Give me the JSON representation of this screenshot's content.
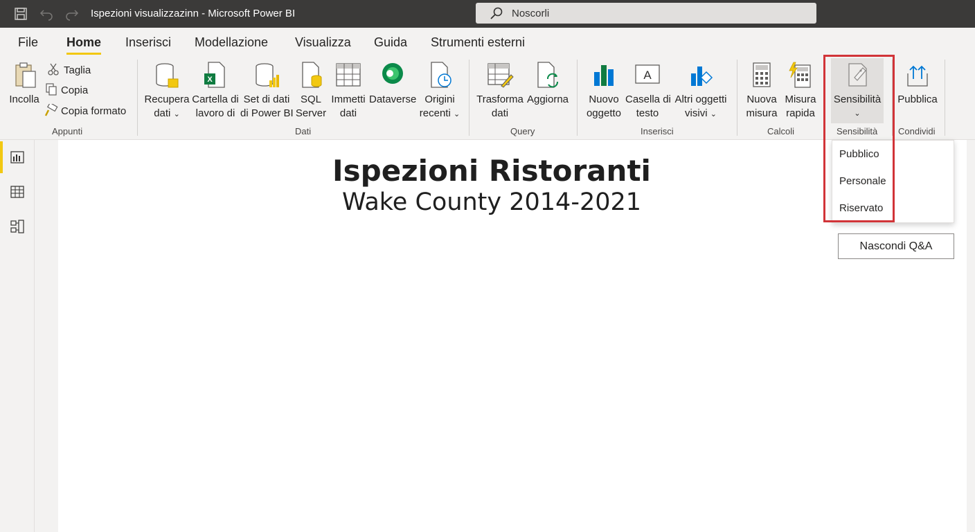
{
  "titlebar": {
    "title": "Ispezioni visualizzazinn  -  Microsoft Power BI",
    "save_icon": "save-icon",
    "undo_icon": "undo-icon",
    "redo_icon": "redo-icon"
  },
  "search": {
    "placeholder": "Noscorli"
  },
  "tabs": [
    {
      "label": "File"
    },
    {
      "label": "Home",
      "active": true
    },
    {
      "label": "Inserisci"
    },
    {
      "label": "Modellazione"
    },
    {
      "label": "Visualizza"
    },
    {
      "label": "Guida"
    },
    {
      "label": "Strumenti esterni"
    }
  ],
  "ribbon": {
    "appunti": {
      "group_label": "Appunti",
      "incolla": "Incolla",
      "taglia": "Taglia",
      "copia": "Copia",
      "copia_formato": "Copia formato"
    },
    "dati": {
      "group_label": "Dati",
      "recupera_1": "Recupera",
      "recupera_2": "dati",
      "cartella_1": "Cartella di",
      "cartella_2": "lavoro di",
      "set_1": "Set di dati",
      "set_2": "di Power BI",
      "sql_1": "SQL",
      "sql_2": "Server",
      "immetti_1": "Immetti",
      "immetti_2": "dati",
      "dataverse": "Dataverse",
      "origini_1": "Origini",
      "origini_2": "recenti"
    },
    "query": {
      "group_label": "Query",
      "trasforma_1": "Trasforma",
      "trasforma_2": "dati",
      "aggiorna": "Aggiorna"
    },
    "inserisci": {
      "group_label": "Inserisci",
      "nuovo_1": "Nuovo",
      "nuovo_2": "oggetto",
      "casella_1": "Casella di",
      "casella_2": "testo",
      "altri_1": "Altri oggetti",
      "altri_2": "visivi"
    },
    "calcoli": {
      "group_label": "Calcoli",
      "nuova_1": "Nuova",
      "nuova_2": "misura",
      "misura_1": "Misura",
      "misura_2": "rapida"
    },
    "sensibilita": {
      "group_label": "Sensibilità",
      "button": "Sensibilità"
    },
    "condividi": {
      "group_label": "Condividi",
      "pubblica": "Pubblica"
    }
  },
  "sensitivity_menu": {
    "items": [
      {
        "label": "Pubblico"
      },
      {
        "label": "Personale"
      },
      {
        "label": "Riservato"
      }
    ]
  },
  "leftnav": {
    "items": [
      "report-view-icon",
      "data-view-icon",
      "model-view-icon"
    ]
  },
  "report": {
    "title": "Ispezioni Ristoranti",
    "subtitle": "Wake County 2014-2021",
    "qa_button": "Nascondi Q&A"
  },
  "colors": {
    "titlebar_bg": "#3b3a39",
    "accent_yellow": "#f2c811",
    "highlight_red": "#d13438"
  }
}
